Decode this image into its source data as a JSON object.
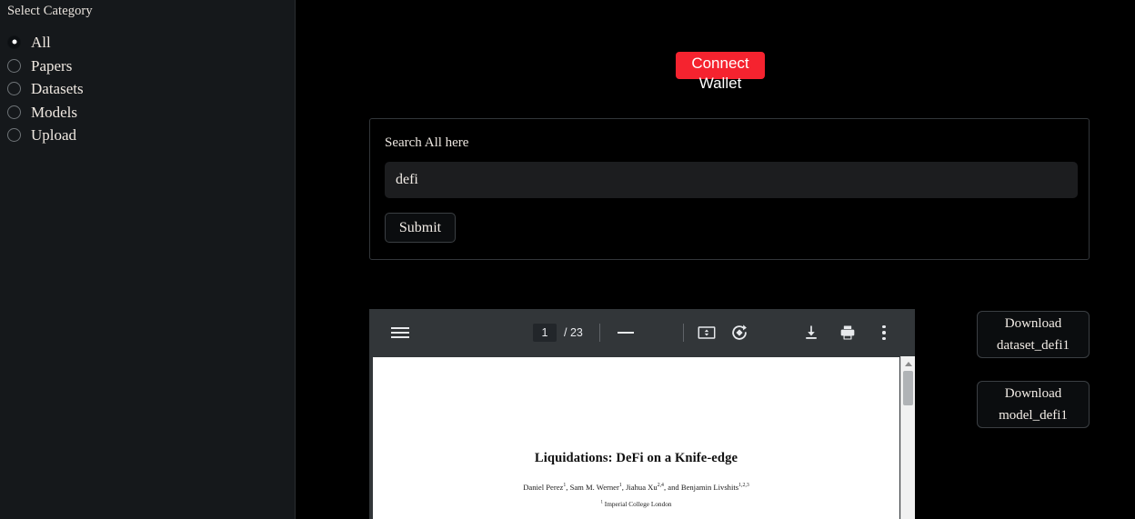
{
  "sidebar": {
    "title": "Select Category",
    "items": [
      {
        "label": "All",
        "selected": true
      },
      {
        "label": "Papers",
        "selected": false
      },
      {
        "label": "Datasets",
        "selected": false
      },
      {
        "label": "Models",
        "selected": false
      },
      {
        "label": "Upload",
        "selected": false
      }
    ]
  },
  "wallet": {
    "label": "Connect Wallet",
    "color": "#f5232f"
  },
  "search": {
    "label": "Search All here",
    "value": "defi",
    "placeholder": "",
    "submit_label": "Submit"
  },
  "pdf": {
    "menu_icon": "hamburger-icon",
    "page_current": "1",
    "page_total": "/ 23",
    "zoom_out_icon": "minus-icon",
    "zoom_in_icon": "plus-icon",
    "fit_icon": "fit-to-page-icon",
    "rotate_icon": "rotate-clockwise-icon",
    "download_icon": "download-icon",
    "print_icon": "print-icon",
    "more_icon": "more-vertical-icon",
    "document": {
      "title": "Liquidations: DeFi on a Knife-edge",
      "authors": "Daniel Perez1, Sam M. Werner1, Jiahua Xu2,4, and Benjamin Livshits1,2,3",
      "affiliation": "1  Imperial College London"
    }
  },
  "downloads": [
    {
      "line1": "Download",
      "line2": "dataset_defi1"
    },
    {
      "line1": "Download",
      "line2": "model_defi1"
    }
  ]
}
